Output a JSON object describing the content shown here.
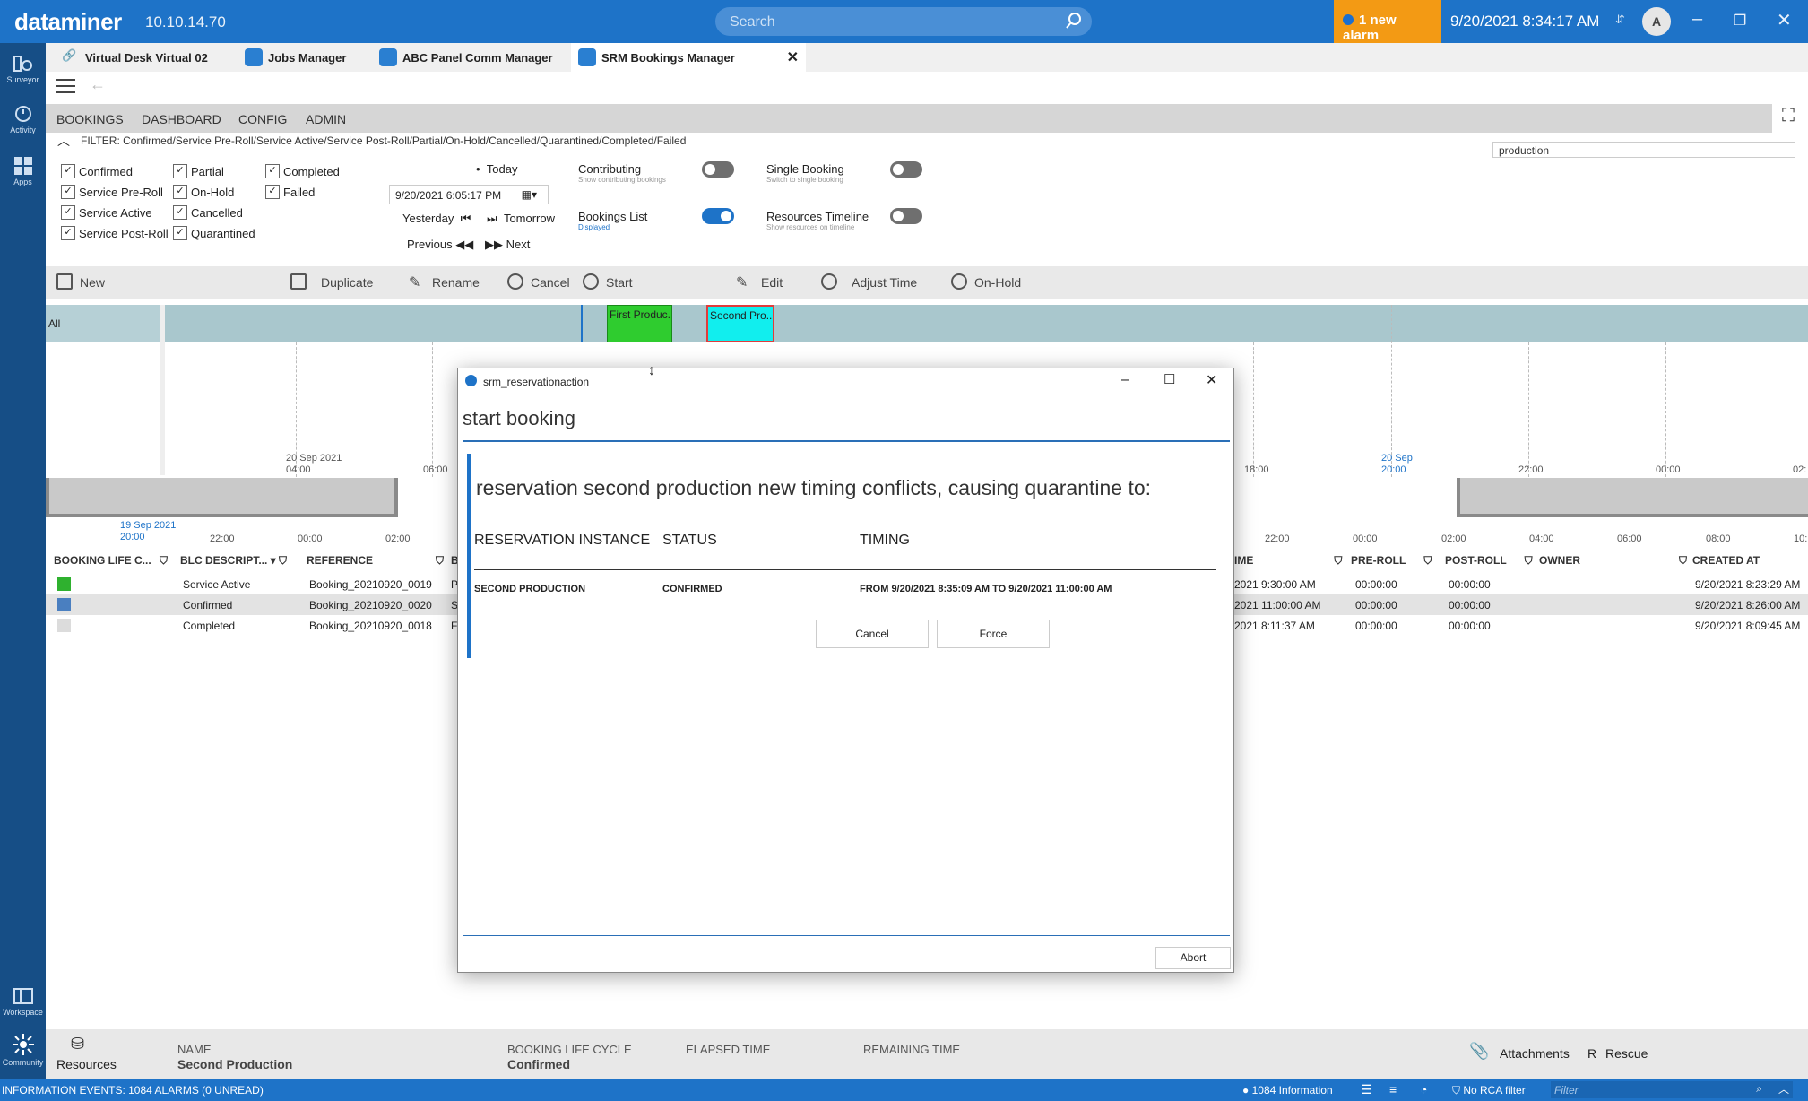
{
  "header": {
    "brand": "dataminer",
    "version": "10.10.14.70",
    "search_placeholder": "Search",
    "alarm": "1 new alarm",
    "datetime": "9/20/2021 8:34:17 AM",
    "avatar": "A",
    "colors": {
      "bar": "#1e73c8",
      "alarm": "#f39a14"
    }
  },
  "rail": {
    "surveyor": "Surveyor",
    "activity": "Activity",
    "apps": "Apps",
    "workspace": "Workspace",
    "community": "Community"
  },
  "tabs": [
    {
      "label": "Virtual Desk Virtual 02"
    },
    {
      "label": "Jobs Manager"
    },
    {
      "label": "ABC Panel Comm Manager"
    },
    {
      "label": "SRM Bookings Manager"
    }
  ],
  "menu": {
    "bookings": "BOOKINGS",
    "dashboard": "DASHBOARD",
    "config": "CONFIG",
    "admin": "ADMIN"
  },
  "filter": {
    "text": "FILTER: Confirmed/Service Pre-Roll/Service Active/Service Post-Roll/Partial/On-Hold/Cancelled/Quarantined/Completed/Failed",
    "search_value": "production"
  },
  "checkboxes": {
    "confirmed": "Confirmed",
    "service_pre_roll": "Service Pre-Roll",
    "service_active": "Service Active",
    "service_post_roll": "Service Post-Roll",
    "partial": "Partial",
    "on_hold": "On-Hold",
    "cancelled": "Cancelled",
    "quarantined": "Quarantined",
    "completed": "Completed",
    "failed": "Failed"
  },
  "datenav": {
    "today": "Today",
    "date": "9/20/2021 6:05:17 PM",
    "yesterday": "Yesterday",
    "tomorrow": "Tomorrow",
    "previous": "Previous",
    "next": "Next"
  },
  "toggles": {
    "contributing": "Contributing",
    "contributing_sub": "Show contributing bookings",
    "single": "Single Booking",
    "single_sub": "Switch to single booking",
    "list": "Bookings List",
    "list_sub": "Displayed",
    "timeline": "Resources Timeline",
    "timeline_sub": "Show resources on timeline"
  },
  "toolbar": {
    "new": "New",
    "duplicate": "Duplicate",
    "rename": "Rename",
    "cancel": "Cancel",
    "start": "Start",
    "edit": "Edit",
    "adjust": "Adjust Time",
    "onhold": "On-Hold"
  },
  "timeline": {
    "all": "All",
    "block1": "First Produc...",
    "block2": "Second Pro...",
    "labels": {
      "date1a": "20 Sep 2021",
      "date1b": "04:00",
      "t0600": "06:00",
      "t1800": "18:00",
      "sep20a": "20 Sep",
      "sep20b": "20:00",
      "t2200": "22:00",
      "t0000": "00:00",
      "t02": "02:",
      "low_date_a": "19 Sep 2021",
      "low_date_b": "20:00",
      "l2200": "22:00",
      "l0000": "00:00",
      "l0200": "02:00",
      "r2200": "22:00",
      "r0000": "00:00",
      "r0200": "02:00",
      "r0400": "04:00",
      "r0600": "06:00",
      "r0800": "08:00",
      "r10": "10:"
    }
  },
  "table": {
    "headers": {
      "lifecycle": "BOOKING LIFE C...",
      "blc": "BLC DESCRIPT...",
      "reference": "REFERENCE",
      "b": "B",
      "time": "IME",
      "preroll": "PRE-ROLL",
      "postroll": "POST-ROLL",
      "owner": "OWNER",
      "created": "CREATED AT"
    },
    "rows": [
      {
        "color": "#2fb12f",
        "blc": "Service Active",
        "ref": "Booking_20210920_0019",
        "b": "P",
        "time": "2021 9:30:00 AM",
        "pre": "00:00:00",
        "post": "00:00:00",
        "created": "9/20/2021 8:23:29 AM"
      },
      {
        "color": "#4a7fc0",
        "blc": "Confirmed",
        "ref": "Booking_20210920_0020",
        "b": "S",
        "time": "2021 11:00:00 AM",
        "pre": "00:00:00",
        "post": "00:00:00",
        "created": "9/20/2021 8:26:00 AM"
      },
      {
        "color": "#dcdcdc",
        "blc": "Completed",
        "ref": "Booking_20210920_0018",
        "b": "F",
        "time": "2021 8:11:37 AM",
        "pre": "00:00:00",
        "post": "00:00:00",
        "created": "9/20/2021 8:09:45 AM"
      }
    ]
  },
  "dialog": {
    "title": "srm_reservationaction",
    "heading": "start booking",
    "message": "reservation second production new timing conflicts, causing quarantine to:",
    "col_instance": "RESERVATION INSTANCE",
    "col_status": "STATUS",
    "col_timing": "TIMING",
    "instance": "SECOND PRODUCTION",
    "status": "CONFIRMED",
    "timing": "FROM 9/20/2021 8:35:09 AM TO 9/20/2021 11:00:00 AM",
    "cancel": "Cancel",
    "force": "Force",
    "abort": "Abort"
  },
  "bottom": {
    "resources": "Resources",
    "name_label": "NAME",
    "name_value": "Second Production",
    "blc_label": "BOOKING LIFE CYCLE",
    "blc_value": "Confirmed",
    "elapsed": "ELAPSED TIME",
    "remaining": "REMAINING TIME",
    "attachments": "Attachments",
    "rescue_key": "R",
    "rescue": "Rescue"
  },
  "status": {
    "left": "INFORMATION EVENTS: 1084 ALARMS (0 UNREAD)",
    "info": "1084 Information",
    "rca": "No RCA filter",
    "filter": "Filter"
  }
}
